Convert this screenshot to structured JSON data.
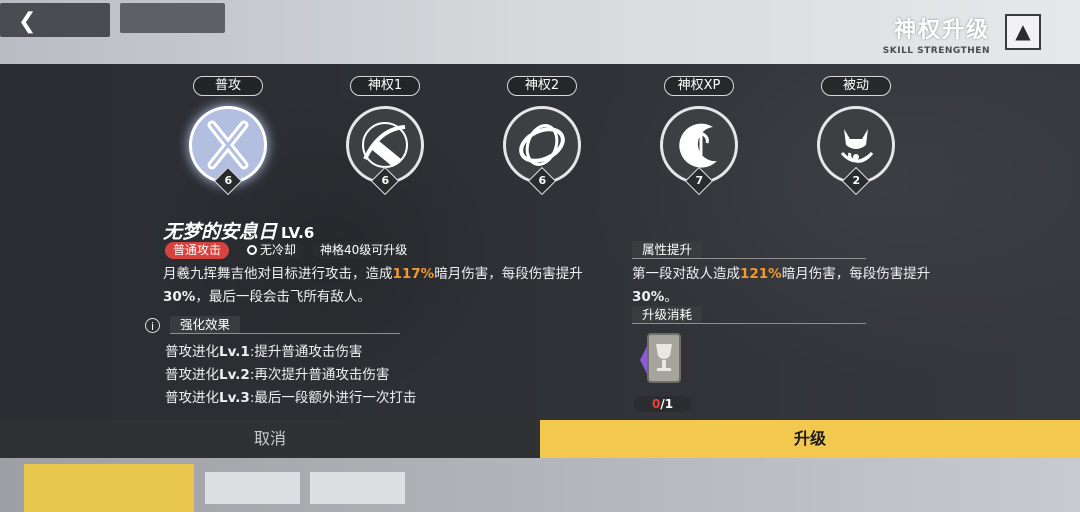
{
  "header": {
    "title": "神权升级",
    "subtitle": "SKILL STRENGTHEN"
  },
  "skills": [
    {
      "tab": "普攻",
      "level": "6",
      "icon": "crossed-blades-icon",
      "active": true
    },
    {
      "tab": "神权1",
      "level": "6",
      "icon": "slash-strike-icon",
      "active": false
    },
    {
      "tab": "神权2",
      "level": "6",
      "icon": "vortex-ring-icon",
      "active": false
    },
    {
      "tab": "神权XP",
      "level": "7",
      "icon": "crescent-note-icon",
      "active": false
    },
    {
      "tab": "被动",
      "level": "2",
      "icon": "fox-spirit-icon",
      "active": false
    }
  ],
  "detail": {
    "name": "无梦的安息日",
    "level_label": "LV.6",
    "tag_type": "普通攻击",
    "tag_cooldown": "无冷却",
    "tag_requirement": "神格40级可升级",
    "desc_parts": [
      "月羲九挥舞吉他对目标进行攻击，造成",
      "117%",
      "暗月伤害，每段伤害提升",
      "30%",
      "，最后一段会击飞所有敌人。"
    ],
    "enhance_title": "强化效果",
    "evolutions": [
      {
        "prefix": "普攻进化",
        "lv": "Lv.1",
        "text": ":提升普通攻击伤害"
      },
      {
        "prefix": "普攻进化",
        "lv": "Lv.2",
        "text": ":再次提升普通攻击伤害"
      },
      {
        "prefix": "普攻进化",
        "lv": "Lv.3",
        "text": ":最后一段额外进行一次打击"
      }
    ],
    "attr_title": "属性提升",
    "attr_parts": [
      "第一段对敌人造成",
      "121%",
      "暗月伤害，每段伤害提升",
      "30%",
      "。"
    ],
    "cost_title": "升级消耗",
    "cost_item_icon": "grail-book-icon",
    "cost_have": "0",
    "cost_need": "/1"
  },
  "buttons": {
    "cancel": "取消",
    "upgrade": "升级"
  },
  "colors": {
    "highlight": "#f39a2e",
    "upgrade_button": "#f2c94e",
    "tag_red": "#d6423e",
    "count_red": "#e6423c"
  }
}
